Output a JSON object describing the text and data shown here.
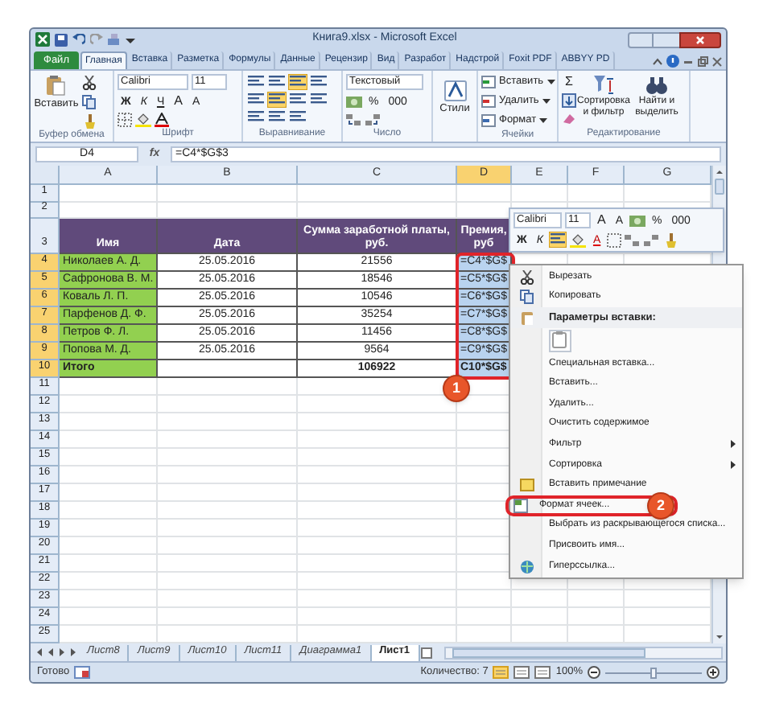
{
  "window": {
    "title": "Книга9.xlsx - Microsoft Excel"
  },
  "ribbon_tabs": [
    {
      "label": "Файл",
      "kind": "file",
      "selected": false
    },
    {
      "label": "Главная",
      "kind": "tab",
      "selected": true
    },
    {
      "label": "Вставка",
      "kind": "tab",
      "selected": false
    },
    {
      "label": "Разметка",
      "kind": "tab",
      "selected": false
    },
    {
      "label": "Формулы",
      "kind": "tab",
      "selected": false
    },
    {
      "label": "Данные",
      "kind": "tab",
      "selected": false
    },
    {
      "label": "Рецензир",
      "kind": "tab",
      "selected": false
    },
    {
      "label": "Вид",
      "kind": "tab",
      "selected": false
    },
    {
      "label": "Разработ",
      "kind": "tab",
      "selected": false
    },
    {
      "label": "Надстрой",
      "kind": "tab",
      "selected": false
    },
    {
      "label": "Foxit PDF",
      "kind": "tab",
      "selected": false
    },
    {
      "label": "ABBYY PD",
      "kind": "tab",
      "selected": false
    }
  ],
  "ribbon": {
    "clipboard": {
      "paste": "Вставить",
      "label": "Буфер обмена"
    },
    "font": {
      "name": "Calibri",
      "size": "11",
      "bold": "Ж",
      "italic": "К",
      "underline": "Ч",
      "grow": "A",
      "shrink": "A",
      "label": "Шрифт"
    },
    "alignment": {
      "label": "Выравнивание",
      "buttons": [
        {
          "selected": false
        },
        {
          "selected": false
        },
        {
          "selected": true
        },
        {
          "selected": false
        },
        {
          "selected": false
        },
        {
          "selected": true
        },
        {
          "selected": false
        },
        {
          "selected": false
        },
        {
          "selected": false
        },
        {
          "selected": false
        },
        {
          "selected": false
        }
      ]
    },
    "number": {
      "format": "Текстовый",
      "percent": "%",
      "thousands": "000",
      "label": "Число"
    },
    "styles": {
      "button": "Стили"
    },
    "cells": {
      "insert": "Вставить",
      "delete": "Удалить",
      "format": "Формат",
      "label": "Ячейки"
    },
    "editing": {
      "sum": "Σ",
      "sort": "Сортировка и фильтр",
      "find": "Найти и выделить",
      "label": "Редактирование"
    }
  },
  "formula_bar": {
    "name_box": "D4",
    "fx": "fx",
    "formula": "=C4*$G$3"
  },
  "columns": [
    {
      "label": "A",
      "selected": false
    },
    {
      "label": "B",
      "selected": false
    },
    {
      "label": "C",
      "selected": false
    },
    {
      "label": "D",
      "selected": true
    },
    {
      "label": "E",
      "selected": false
    },
    {
      "label": "F",
      "selected": false
    },
    {
      "label": "G",
      "selected": false
    }
  ],
  "rows": [
    {
      "number": "1",
      "kind": "blank",
      "selected": false
    },
    {
      "number": "2",
      "kind": "blank",
      "selected": false
    },
    {
      "number": "3",
      "kind": "header",
      "selected": false,
      "cells": [
        "Имя",
        "Дата",
        "Сумма заработной платы, руб.",
        "Премия, руб"
      ]
    },
    {
      "number": "4",
      "kind": "data",
      "selected": true,
      "cells": [
        "Николаев А. Д.",
        "25.05.2016",
        "21556",
        "=C4*$G$"
      ]
    },
    {
      "number": "5",
      "kind": "data",
      "selected": true,
      "cells": [
        "Сафронова В. М.",
        "25.05.2016",
        "18546",
        "=C5*$G$"
      ]
    },
    {
      "number": "6",
      "kind": "data",
      "selected": true,
      "cells": [
        "Коваль Л. П.",
        "25.05.2016",
        "10546",
        "=C6*$G$"
      ]
    },
    {
      "number": "7",
      "kind": "data",
      "selected": true,
      "cells": [
        "Парфенов Д. Ф.",
        "25.05.2016",
        "35254",
        "=C7*$G$"
      ]
    },
    {
      "number": "8",
      "kind": "data",
      "selected": true,
      "cells": [
        "Петров Ф. Л.",
        "25.05.2016",
        "11456",
        "=C8*$G$"
      ]
    },
    {
      "number": "9",
      "kind": "data",
      "selected": true,
      "cells": [
        "Попова М. Д.",
        "25.05.2016",
        "9564",
        "=C9*$G$"
      ]
    },
    {
      "number": "10",
      "kind": "total",
      "selected": true,
      "cells": [
        "Итого",
        "",
        "106922",
        "C10*$G$"
      ]
    },
    {
      "number": "11",
      "kind": "blank",
      "selected": false
    },
    {
      "number": "12",
      "kind": "blank",
      "selected": false
    },
    {
      "number": "13",
      "kind": "blank",
      "selected": false
    },
    {
      "number": "14",
      "kind": "blank",
      "selected": false
    },
    {
      "number": "15",
      "kind": "blank",
      "selected": false
    },
    {
      "number": "16",
      "kind": "blank",
      "selected": false
    },
    {
      "number": "17",
      "kind": "blank",
      "selected": false
    },
    {
      "number": "18",
      "kind": "blank",
      "selected": false
    },
    {
      "number": "19",
      "kind": "blank",
      "selected": false
    },
    {
      "number": "20",
      "kind": "blank",
      "selected": false
    },
    {
      "number": "21",
      "kind": "blank",
      "selected": false
    },
    {
      "number": "22",
      "kind": "blank",
      "selected": false
    },
    {
      "number": "23",
      "kind": "blank",
      "selected": false
    },
    {
      "number": "24",
      "kind": "blank",
      "selected": false
    },
    {
      "number": "25",
      "kind": "blank",
      "selected": false
    }
  ],
  "mini_toolbar": {
    "font": "Calibri",
    "size": "11",
    "grow": "A",
    "shrink": "A",
    "percent": "%",
    "thousands": "000",
    "bold": "Ж",
    "italic": "К",
    "font_color": "A"
  },
  "context_menu": [
    {
      "kind": "item",
      "label": "Вырезать",
      "submenu": false
    },
    {
      "kind": "item",
      "label": "Копировать",
      "submenu": false
    },
    {
      "kind": "section",
      "label": "Параметры вставки:"
    },
    {
      "kind": "paste_icons"
    },
    {
      "kind": "item",
      "label": "Специальная вставка...",
      "submenu": false
    },
    {
      "kind": "item",
      "label": "Вставить...",
      "submenu": false
    },
    {
      "kind": "item",
      "label": "Удалить...",
      "submenu": false
    },
    {
      "kind": "item",
      "label": "Очистить содержимое",
      "submenu": false
    },
    {
      "kind": "item",
      "label": "Фильтр",
      "submenu": true
    },
    {
      "kind": "item",
      "label": "Сортировка",
      "submenu": true
    },
    {
      "kind": "item",
      "label": "Вставить примечание",
      "submenu": false
    },
    {
      "kind": "item",
      "label": "Формат ячеек...",
      "submenu": false
    },
    {
      "kind": "item",
      "label": "Выбрать из раскрывающегося списка...",
      "submenu": false
    },
    {
      "kind": "item",
      "label": "Присвоить имя...",
      "submenu": false
    },
    {
      "kind": "item",
      "label": "Гиперссылка...",
      "submenu": false
    }
  ],
  "callouts": [
    {
      "number": "1"
    },
    {
      "number": "2"
    }
  ],
  "sheet_tabs": [
    {
      "label": "Лист8",
      "selected": false
    },
    {
      "label": "Лист9",
      "selected": false
    },
    {
      "label": "Лист10",
      "selected": false
    },
    {
      "label": "Лист11",
      "selected": false
    },
    {
      "label": "Диаграмма1",
      "selected": false
    },
    {
      "label": "Лист1",
      "selected": true
    }
  ],
  "status_bar": {
    "ready": "Готово",
    "count": "Количество: 7",
    "zoom": "100%",
    "views": [
      {
        "selected": true
      },
      {
        "selected": false
      },
      {
        "selected": false
      }
    ],
    "zoom_slider": {
      "level": 0.5
    }
  }
}
